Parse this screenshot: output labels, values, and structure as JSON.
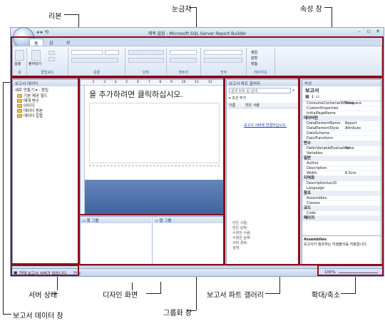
{
  "callouts": {
    "ribbon": "리본",
    "ruler": "눈금자",
    "properties_pane": "속성 창",
    "server_status": "서버 상태",
    "design_surface": "디자인 화면",
    "grouping_pane": "그룹화 창",
    "report_part_gallery": "보고서 파트 갤러리",
    "zoom": "확대/축소",
    "report_data_pane": "보고서 데이터 창"
  },
  "window": {
    "title": "제목 없음 - Microsoft SQL Server Report Builder",
    "tabs": [
      "홈",
      "삽입",
      "보기"
    ]
  },
  "ribbon_groups": [
    "보",
    "클립보드",
    "글꼴",
    "단락",
    "테두리",
    "숫자",
    "레이아웃"
  ],
  "ribbon_buttons": {
    "run": "실행",
    "paste": "붙여넣기",
    "merge": "병합",
    "split": "분할",
    "align": "맞춤"
  },
  "report_data": {
    "title": "보고서 데이터",
    "new_menu": "새로 만들기",
    "edit_menu": "편집",
    "tree": [
      "기본 제공 필드",
      "매개 변수",
      "이미지",
      "데이터 원본",
      "데이터 집합"
    ]
  },
  "design": {
    "placeholder": "을 추가하려면 클릭하십시오.",
    "ruler": [
      "2",
      "3",
      "4",
      "5",
      "6",
      "7",
      "8",
      "9",
      "10",
      "11",
      "12"
    ]
  },
  "grouping": {
    "row_groups": "행 그룹",
    "column_groups": "열 그룹"
  },
  "gallery": {
    "title": "보고서 파트 갤러리",
    "search_placeholder": "검색 파트 값 검색",
    "add_label": "조건 추가",
    "col_name": "이름",
    "col_author": "만든 사람",
    "connect_link": "보고서 서버에 연결하십시오.",
    "detail_labels": [
      "만든 사람:",
      "만든 날짜:",
      "수정한 사람:",
      "수정한 날짜:",
      "서버 경로:",
      "설명:"
    ]
  },
  "properties": {
    "title": "속성",
    "subject": "보고서",
    "rows": [
      {
        "cat": false,
        "name": "ConsumeContainerWhitespace",
        "value": "False"
      },
      {
        "cat": false,
        "name": "CustomProperties",
        "value": ""
      },
      {
        "cat": false,
        "name": "InitialPageName",
        "value": ""
      },
      {
        "cat": true,
        "name": "데이터만",
        "value": ""
      },
      {
        "cat": false,
        "name": "DataElementName",
        "value": "Report"
      },
      {
        "cat": false,
        "name": "DataElementStyle",
        "value": "Attribute"
      },
      {
        "cat": false,
        "name": "DataSchema",
        "value": ""
      },
      {
        "cat": false,
        "name": "DataTransform",
        "value": ""
      },
      {
        "cat": true,
        "name": "변수",
        "value": ""
      },
      {
        "cat": false,
        "name": "DeferVariableEvaluation",
        "value": "False"
      },
      {
        "cat": false,
        "name": "Variables",
        "value": ""
      },
      {
        "cat": true,
        "name": "일반",
        "value": ""
      },
      {
        "cat": false,
        "name": "Author",
        "value": ""
      },
      {
        "cat": false,
        "name": "Description",
        "value": ""
      },
      {
        "cat": false,
        "name": "Width",
        "value": "6.5cm"
      },
      {
        "cat": true,
        "name": "지역화",
        "value": ""
      },
      {
        "cat": false,
        "name": "DescriptionLocID",
        "value": ""
      },
      {
        "cat": false,
        "name": "Language",
        "value": ""
      },
      {
        "cat": true,
        "name": "참조",
        "value": ""
      },
      {
        "cat": false,
        "name": "Assemblies",
        "value": ""
      },
      {
        "cat": false,
        "name": "Classes",
        "value": ""
      },
      {
        "cat": true,
        "name": "코드",
        "value": ""
      },
      {
        "cat": false,
        "name": "Code",
        "value": ""
      },
      {
        "cat": true,
        "name": "페이지",
        "value": ""
      }
    ],
    "desc_title": "Assemblies",
    "desc_text": "보고서가 참조하는 어셈블리를 지정합니다."
  },
  "status": {
    "server_text": "현재 보고서 서버가 없습니다.",
    "connect": "연결",
    "zoom": "100%"
  }
}
